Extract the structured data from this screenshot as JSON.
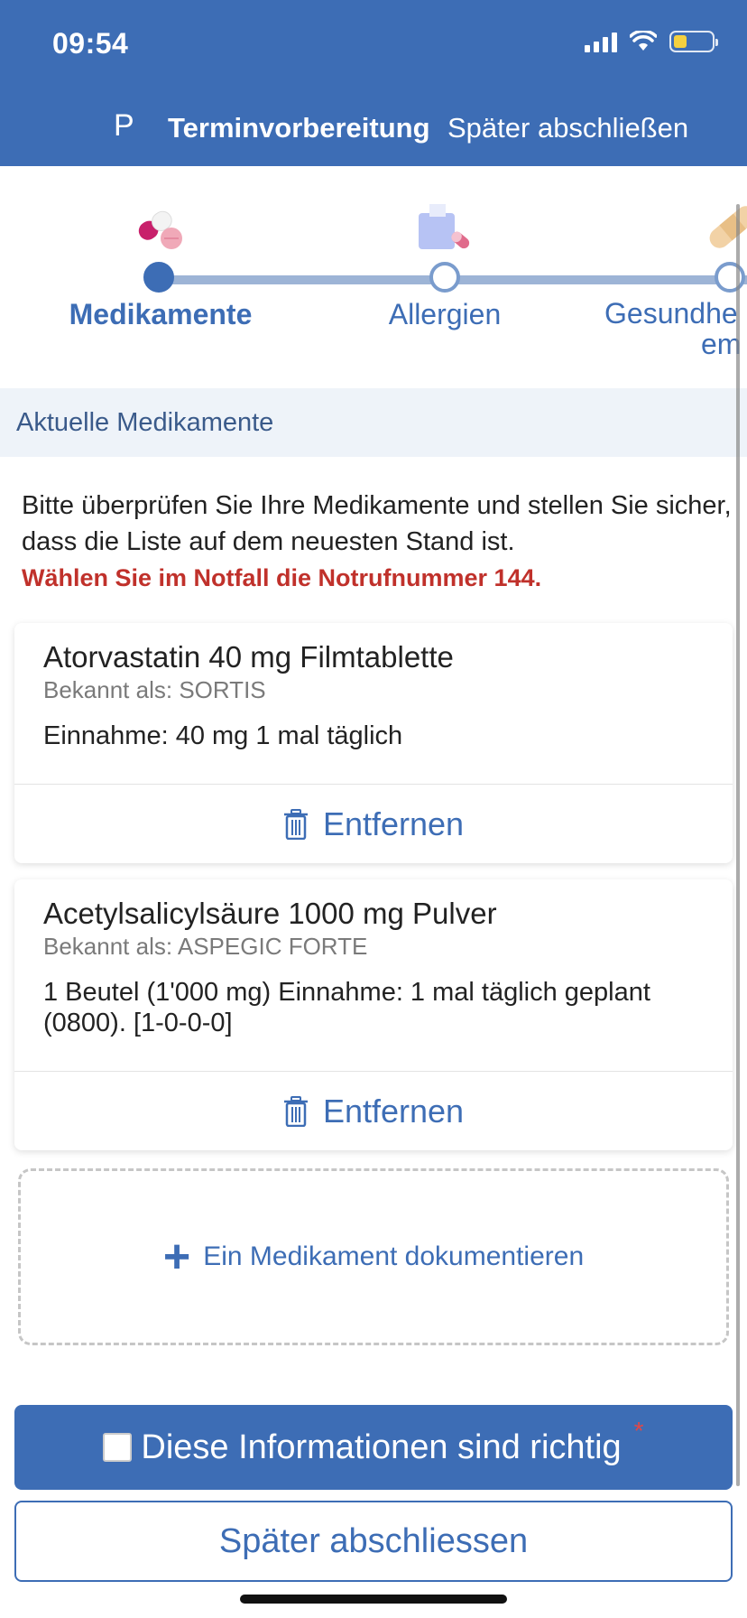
{
  "status_bar": {
    "time": "09:54"
  },
  "nav": {
    "letter": "P",
    "title": "Terminvorbereitung",
    "later_action": "Später abschließen"
  },
  "steps": [
    {
      "label": "Medikamente",
      "icon": "pill-icon",
      "state": "active"
    },
    {
      "label": "Allergien",
      "icon": "allergy-icon",
      "state": "upcoming"
    },
    {
      "label": "Gesundheitsprobleme",
      "label_line1": "Gesundhe",
      "label_line2": "em",
      "icon": "bandage-icon",
      "state": "upcoming"
    }
  ],
  "section": {
    "title": "Aktuelle Medikamente"
  },
  "intro": {
    "text": "Bitte überprüfen Sie Ihre Medikamente und stellen Sie sicher, dass die Liste auf dem neuesten Stand ist.",
    "warning": "Wählen Sie im Notfall die Notrufnummer 144."
  },
  "medications": [
    {
      "name": "Atorvastatin 40 mg Filmtablette",
      "known_as": "Bekannt als: SORTIS",
      "dose": "Einnahme: 40 mg 1 mal täglich",
      "remove_label": "Entfernen"
    },
    {
      "name": "Acetylsalicylsäure 1000 mg Pulver",
      "known_as": "Bekannt als: ASPEGIC FORTE",
      "dose": "1 Beutel (1'000 mg) Einnahme: 1 mal täglich geplant (0800). [1-0-0-0]",
      "remove_label": "Entfernen"
    }
  ],
  "add_medication": {
    "label": "Ein Medikament dokumentieren"
  },
  "confirm": {
    "label": "Diese Informationen sind richtig",
    "required_mark": "*",
    "checked": false
  },
  "later_button": {
    "label": "Später abschliessen"
  },
  "colors": {
    "primary": "#3d6db5",
    "warning": "#c0312b",
    "section_bg": "#eef3f9"
  }
}
